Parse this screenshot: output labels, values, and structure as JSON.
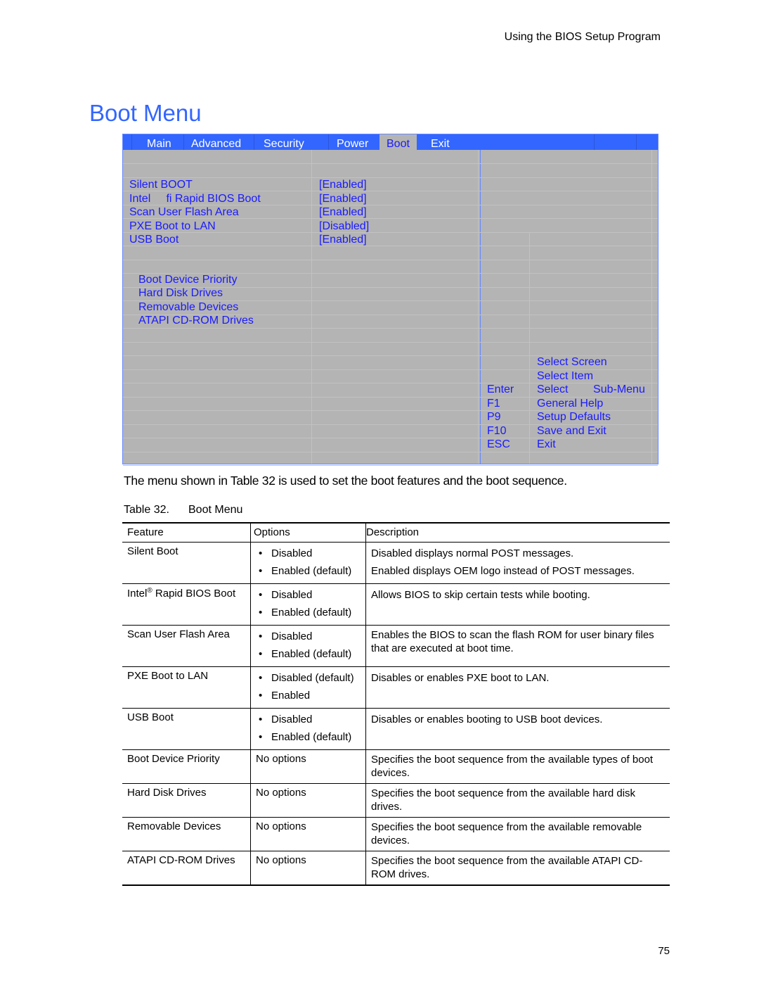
{
  "running_header": "Using the BIOS Setup Program",
  "page_title": "Boot Menu",
  "bios": {
    "tabs": [
      {
        "label": "Main",
        "active": false
      },
      {
        "label": "Advanced",
        "active": false
      },
      {
        "label": "Security",
        "active": false
      },
      {
        "label": "Power",
        "active": false
      },
      {
        "label": "Boot",
        "active": true
      },
      {
        "label": "Exit",
        "active": false
      }
    ],
    "settings": [
      {
        "label": "Silent BOOT",
        "value": "[Enabled]"
      },
      {
        "label": "Intel     fi Rapid BIOS Boot",
        "value": "[Enabled]"
      },
      {
        "label": "Scan User Flash Area",
        "value": "[Enabled]"
      },
      {
        "label": "PXE Boot to LAN",
        "value": "[Disabled]"
      },
      {
        "label": "USB Boot",
        "value": "[Enabled]"
      }
    ],
    "submenus": [
      "Boot Device Priority",
      "Hard Disk Drives",
      "Removable Devices",
      "ATAPI CD-ROM Drives"
    ],
    "help_keys": [
      {
        "key": "",
        "action": "Select Screen"
      },
      {
        "key": "",
        "action": "Select Item"
      },
      {
        "key": "Enter",
        "action": "Select        Sub-Menu"
      },
      {
        "key": "F1",
        "action": "General Help"
      },
      {
        "key": "P9",
        "action": "Setup Defaults"
      },
      {
        "key": "F10",
        "action": "Save and Exit"
      },
      {
        "key": "ESC",
        "action": "Exit"
      }
    ]
  },
  "intro_text": "The menu shown in Table 32 is used to set the boot features and the boot sequence.",
  "caption": {
    "number": "Table 32.",
    "title": "Boot Menu"
  },
  "table": {
    "headers": [
      "Feature",
      "Options",
      "Description"
    ],
    "rows": [
      {
        "feature": "Silent Boot",
        "options": [
          "Disabled",
          "Enabled (default)"
        ],
        "description": [
          "Disabled displays normal POST messages.",
          "Enabled displays OEM logo instead of POST messages."
        ]
      },
      {
        "feature": "Intel",
        "feature_sup": "®",
        "feature_rest": " Rapid BIOS Boot",
        "options": [
          "Disabled",
          "Enabled (default)"
        ],
        "description": [
          "Allows BIOS to skip certain tests while booting."
        ]
      },
      {
        "feature": "Scan User Flash Area",
        "options": [
          "Disabled",
          "Enabled (default)"
        ],
        "description_wrap": "Enables the BIOS to scan the flash ROM for user binary files that are executed at boot time."
      },
      {
        "feature": "PXE Boot to LAN",
        "options": [
          "Disabled (default)",
          "Enabled"
        ],
        "description": [
          "Disables or enables PXE boot to LAN."
        ]
      },
      {
        "feature": "USB Boot",
        "options": [
          "Disabled",
          "Enabled (default)"
        ],
        "description": [
          "Disables or enables booting to USB boot devices."
        ]
      },
      {
        "feature": "Boot Device Priority",
        "options_text": "No options",
        "description_wrap": "Specifies the boot sequence from the available types of boot devices."
      },
      {
        "feature": "Hard Disk Drives",
        "options_text": "No options",
        "description_wrap": "Specifies the boot sequence from the available hard disk drives."
      },
      {
        "feature": "Removable Devices",
        "options_text": "No options",
        "description_wrap": "Specifies the boot sequence from the available removable devices."
      },
      {
        "feature": "ATAPI CD-ROM Drives",
        "options_text": "No options",
        "description_wrap": "Specifies the boot sequence from the available ATAPI CD-ROM drives."
      }
    ]
  },
  "page_number": "75"
}
